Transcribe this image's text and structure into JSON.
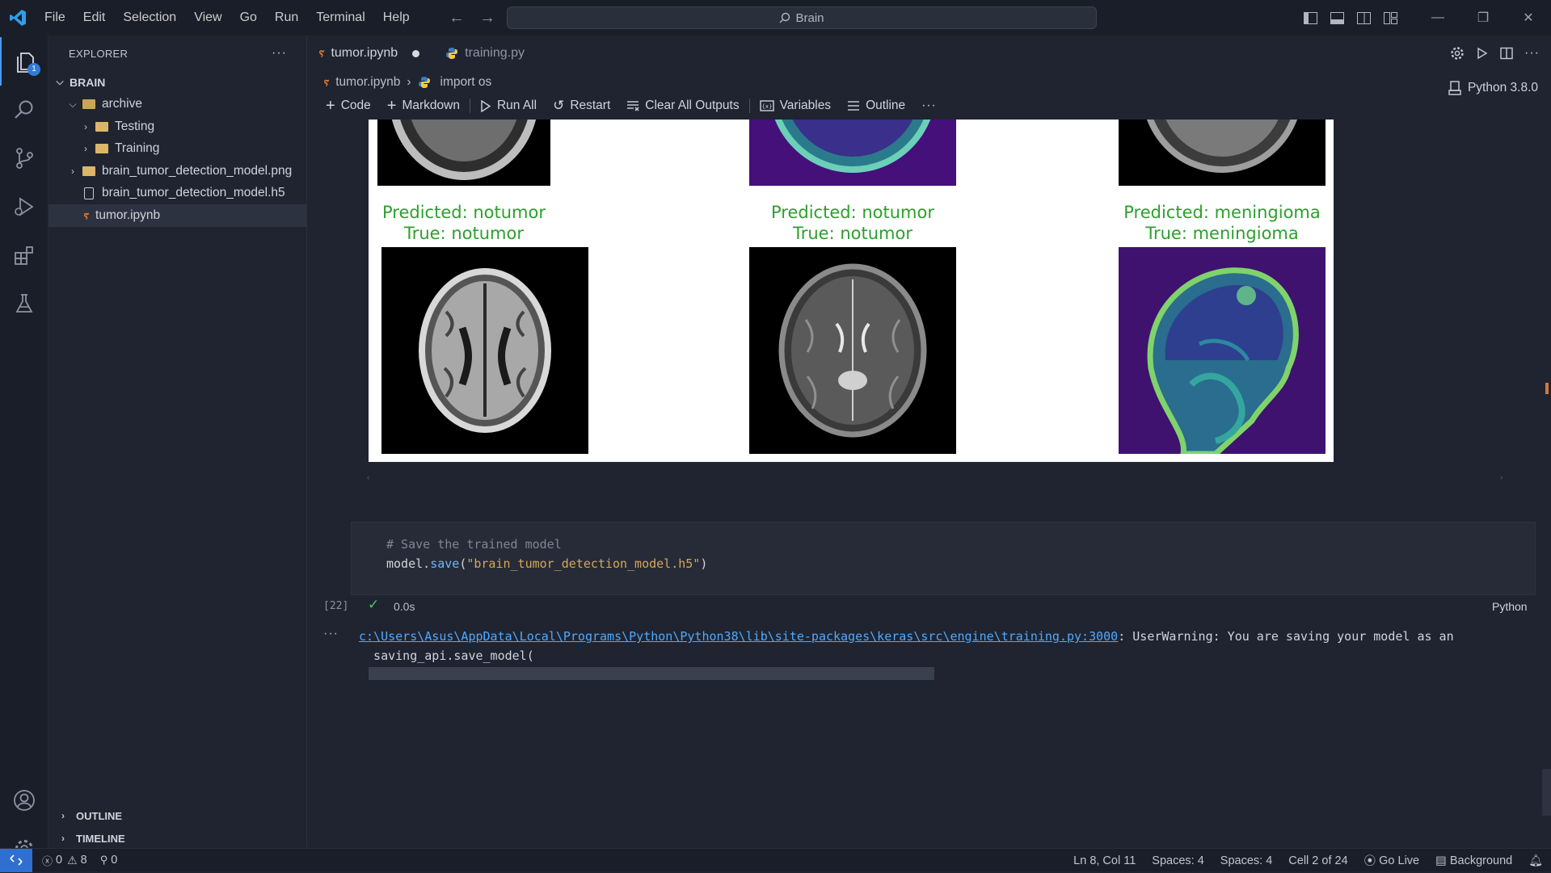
{
  "menu": [
    "File",
    "Edit",
    "Selection",
    "View",
    "Go",
    "Run",
    "Terminal",
    "Help"
  ],
  "command_center": "Brain",
  "activity_badge": "1",
  "explorer": {
    "title": "EXPLORER",
    "more": "···",
    "root": "BRAIN",
    "items": [
      {
        "label": "archive"
      },
      {
        "label": "Testing"
      },
      {
        "label": "Training"
      },
      {
        "label": "brain_tumor_detection_model.png"
      },
      {
        "label": "brain_tumor_detection_model.h5"
      },
      {
        "label": "tumor.ipynb"
      }
    ],
    "outline": "OUTLINE",
    "timeline": "TIMELINE"
  },
  "tabs": [
    {
      "label": "tumor.ipynb"
    },
    {
      "label": "training.py"
    }
  ],
  "breadcrumb": {
    "file": "tumor.ipynb",
    "symbol": "import os"
  },
  "toolbar": {
    "code": "Code",
    "markdown": "Markdown",
    "run_all": "Run All",
    "restart": "Restart",
    "clear": "Clear All Outputs",
    "variables": "Variables",
    "outline": "Outline",
    "more": "···",
    "kernel": "Python 3.8.0"
  },
  "predictions": [
    {
      "predicted": "Predicted: notumor",
      "true": "True: notumor"
    },
    {
      "predicted": "Predicted: notumor",
      "true": "True: notumor"
    },
    {
      "predicted": "Predicted: meningioma",
      "true": "True: meningioma"
    }
  ],
  "cell": {
    "comment": "# Save the trained model",
    "code_obj": "model",
    "code_dot": ".",
    "code_fn": "save",
    "code_open": "(",
    "code_str": "\"brain_tumor_detection_model.h5\"",
    "code_close": ")",
    "exec_count": "[22]",
    "duration": "0.0s",
    "language": "Python"
  },
  "output": {
    "more": "···",
    "path": "c:\\Users\\Asus\\AppData\\Local\\Programs\\Python\\Python38\\lib\\site-packages\\keras\\src\\engine\\training.py:3000",
    "message": ": UserWarning: You are saving your model as an",
    "line2": "  saving_api.save_model("
  },
  "statusbar": {
    "errors": "0",
    "warnings": "8",
    "ports": "0",
    "position": "Ln 8, Col 11",
    "spaces1": "Spaces: 4",
    "spaces2": "Spaces: 4",
    "cell": "Cell 2 of 24",
    "golive": "Go Live",
    "background": "Background"
  },
  "colors": {
    "accent": "#2f7bd8",
    "caption_green": "#2ca02c",
    "editor_bg": "#1f2430"
  }
}
